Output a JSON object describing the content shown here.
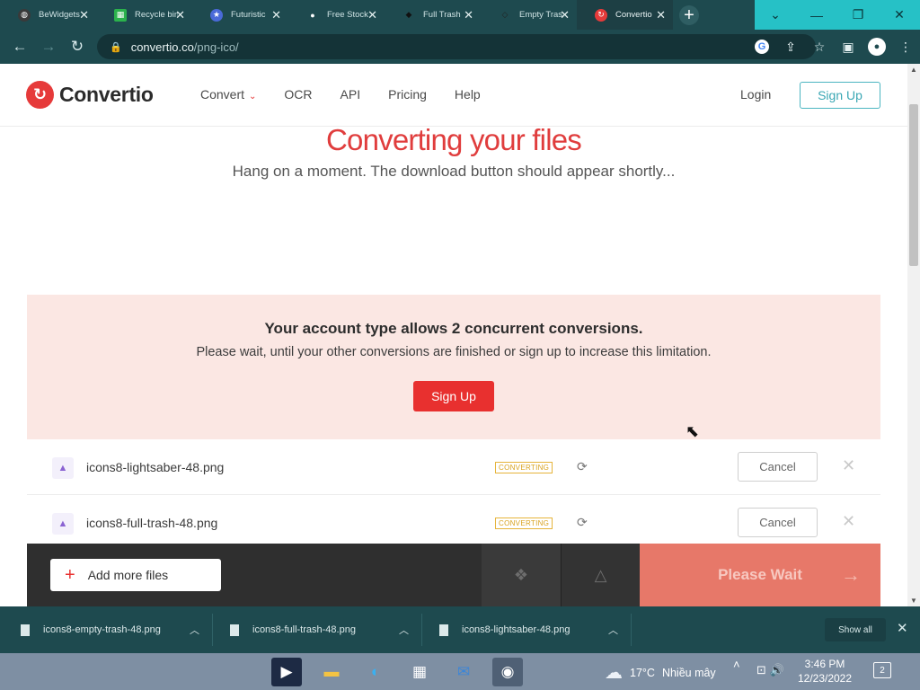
{
  "tabs": [
    {
      "title": "BeWidgets",
      "favicon_color": "#3a3a3a"
    },
    {
      "title": "Recycle bin",
      "favicon_color": "#2bb24c"
    },
    {
      "title": "Futuristic",
      "favicon_color": "#4a6ad8"
    },
    {
      "title": "Free Stock",
      "favicon_color": "#111111"
    },
    {
      "title": "Full Trash",
      "favicon_color": "#222222"
    },
    {
      "title": "Empty Trash",
      "favicon_color": "#444444"
    },
    {
      "title": "Convertio",
      "favicon_color": "#e63a3a",
      "active": true
    }
  ],
  "address": {
    "domain": "convertio.co",
    "path": "/png-ico/"
  },
  "site": {
    "logo": "Convertio",
    "nav": [
      "Convert",
      "OCR",
      "API",
      "Pricing",
      "Help"
    ],
    "login": "Login",
    "signup": "Sign Up"
  },
  "conversion": {
    "title": "Converting your files",
    "subtitle": "Hang on a moment. The download button should appear shortly..."
  },
  "limit": {
    "title": "Your account type allows 2 concurrent conversions.",
    "text": "Please wait, until your other conversions are finished or sign up to increase this limitation.",
    "button": "Sign Up"
  },
  "files": [
    {
      "name": "icons8-lightsaber-48.png",
      "status": "CONVERTING",
      "cancel": "Cancel"
    },
    {
      "name": "icons8-full-trash-48.png",
      "status": "CONVERTING",
      "cancel": "Cancel"
    }
  ],
  "bottombar": {
    "add_more": "Add more files",
    "action": "Please Wait"
  },
  "downloads": [
    {
      "name": "icons8-empty-trash-48.png"
    },
    {
      "name": "icons8-full-trash-48.png"
    },
    {
      "name": "icons8-lightsaber-48.png"
    }
  ],
  "show_all": "Show all",
  "taskbar": {
    "weather_temp": "17°C",
    "weather_text": "Nhiều mây",
    "time": "3:46 PM",
    "date": "12/23/2022",
    "notifications": "2"
  },
  "colors": {
    "brand": "#e63a3a",
    "accent": "#3aa7b4",
    "chrome": "#1e4a4f"
  }
}
